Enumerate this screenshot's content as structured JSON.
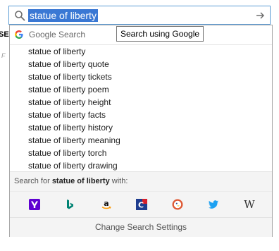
{
  "background": {
    "partial_text_a": "SEC",
    "partial_text_b": "F"
  },
  "search_bar": {
    "query": "statue of liberty"
  },
  "header": {
    "engine_label": "Google Search",
    "tooltip": "Search using Google"
  },
  "suggestions": [
    "statue of liberty",
    "statue of liberty quote",
    "statue of liberty tickets",
    "statue of liberty poem",
    "statue of liberty height",
    "statue of liberty facts",
    "statue of liberty history",
    "statue of liberty meaning",
    "statue of liberty torch",
    "statue of liberty drawing"
  ],
  "search_for": {
    "prefix": "Search for ",
    "term": "statue of liberty",
    "suffix": " with:"
  },
  "engines": [
    {
      "name": "Yahoo",
      "icon": "yahoo-icon",
      "color": "#5f01d1"
    },
    {
      "name": "Bing",
      "icon": "bing-icon",
      "color": "#008373"
    },
    {
      "name": "Amazon",
      "icon": "amazon-icon",
      "color": "#ff9900"
    },
    {
      "name": "Chambers",
      "icon": "chambers-icon",
      "color": "#1e3d8f"
    },
    {
      "name": "DuckDuckGo",
      "icon": "duckduckgo-icon",
      "color": "#de5833"
    },
    {
      "name": "Twitter",
      "icon": "twitter-icon",
      "color": "#1da1f2"
    },
    {
      "name": "Wikipedia",
      "icon": "wikipedia-icon",
      "color": "#333333"
    }
  ],
  "footer": {
    "settings_label": "Change Search Settings"
  },
  "colors": {
    "accent": "#3a78d4",
    "border_focus": "#5a9bd5"
  }
}
